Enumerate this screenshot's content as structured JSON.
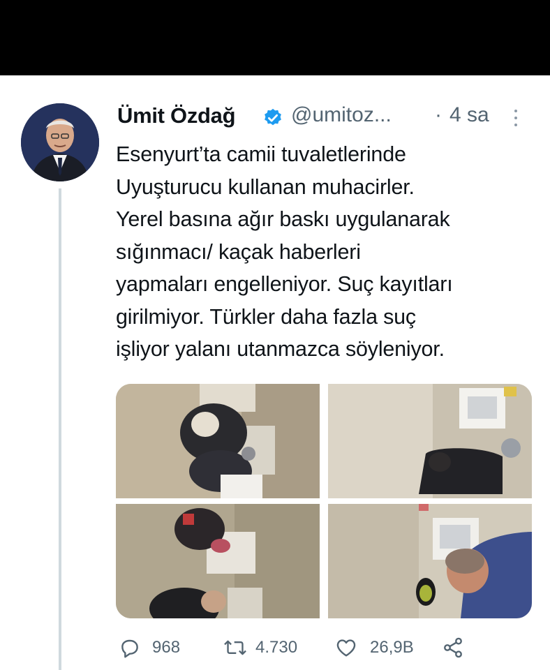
{
  "tweet": {
    "author_name": "Ümit Özdağ",
    "handle": "@umitoz...",
    "separator": "·",
    "time": "4 sa",
    "text_lines": [
      "Esenyurt’ta camii tuvaletlerinde",
      "Uyuşturucu kullanan muhacirler.",
      "Yerel basına ağır baskı uygulanarak",
      "sığınmacı/ kaçak haberleri",
      "yapmaları engelleniyor. Suç kayıtları",
      "girilmiyor. Türkler daha fazla suç",
      "işliyor yalanı utanmazca söyleniyor."
    ]
  },
  "actions": {
    "reply_count": "968",
    "retweet_count": "4.730",
    "like_count": "26,9B"
  },
  "icons": {
    "verified": "verified-badge-icon",
    "more": "more-vertical-icon",
    "reply": "reply-icon",
    "retweet": "retweet-icon",
    "like": "heart-icon",
    "share": "share-icon"
  },
  "colors": {
    "verified_blue": "#1d9bf0",
    "secondary_text": "#536471",
    "primary_text": "#0f1419",
    "thread_line": "#cfd9de"
  }
}
